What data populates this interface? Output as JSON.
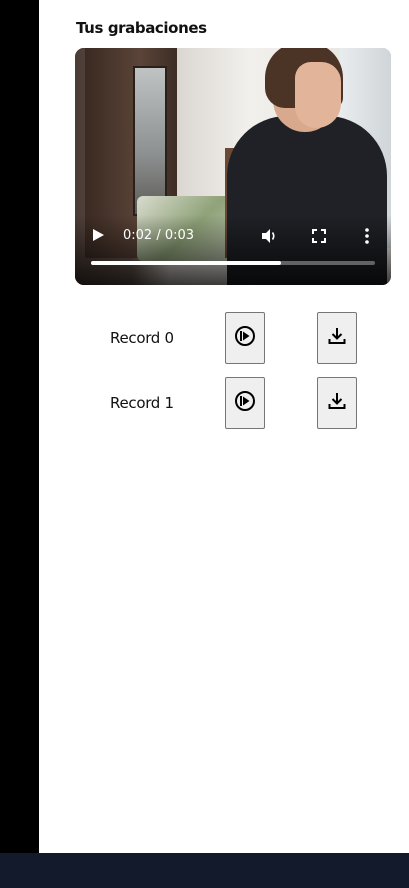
{
  "section_title": "Tus grabaciones",
  "video_player": {
    "time_display": "0:02 / 0:03",
    "progress": 0.67,
    "icons": {
      "play": "play-icon",
      "volume": "volume-icon",
      "fullscreen": "fullscreen-icon",
      "more": "more-options-icon"
    }
  },
  "recordings": [
    {
      "label": "Record 0",
      "play_icon": "play-circle-icon",
      "download_icon": "download-icon"
    },
    {
      "label": "Record 1",
      "play_icon": "play-circle-icon",
      "download_icon": "download-icon"
    }
  ],
  "colors": {
    "sidebar": "#000000",
    "main_background": "#ffffff",
    "footer": "#131a2b",
    "button_bg": "#efefef",
    "button_border": "#767676"
  }
}
